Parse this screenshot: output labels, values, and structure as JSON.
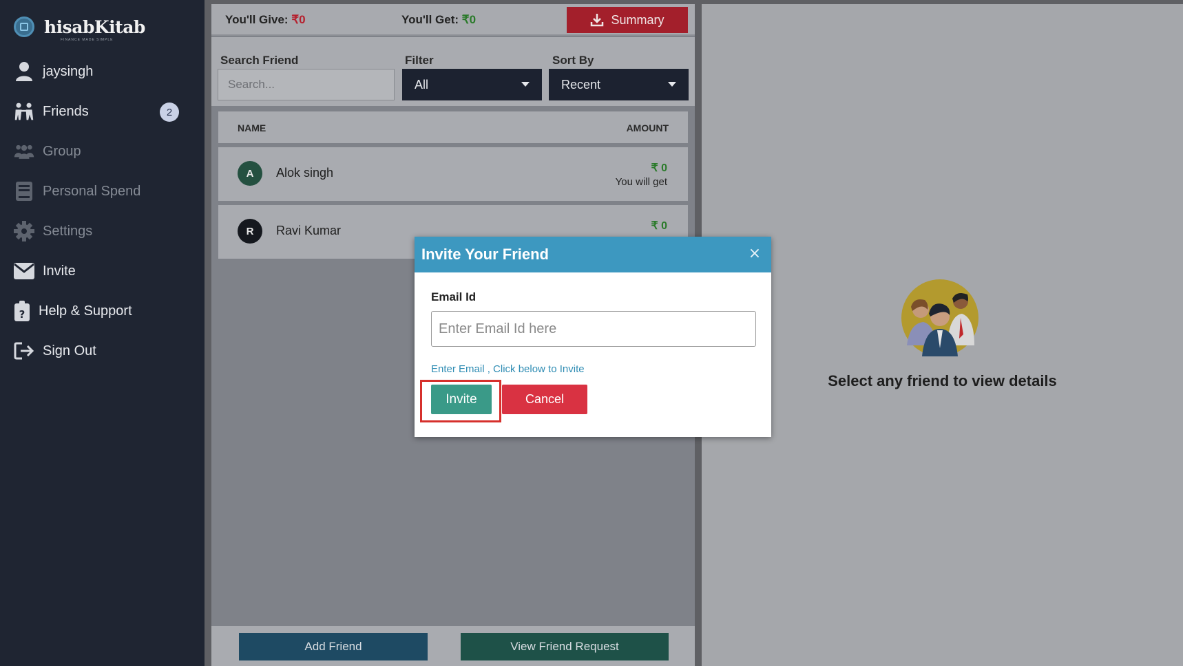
{
  "brand": {
    "name": "hisabKitab",
    "tagline": "FINANCE MADE SIMPLE"
  },
  "sidebar": {
    "items": [
      {
        "label": "jaysingh",
        "icon": "user-icon"
      },
      {
        "label": "Friends",
        "icon": "friends-icon",
        "badge": "2"
      },
      {
        "label": "Group",
        "icon": "group-icon"
      },
      {
        "label": "Personal Spend",
        "icon": "book-icon"
      },
      {
        "label": "Settings",
        "icon": "gear-icon"
      },
      {
        "label": "Invite",
        "icon": "envelope-icon"
      },
      {
        "label": "Help & Support",
        "icon": "clipboard-question-icon"
      },
      {
        "label": "Sign Out",
        "icon": "sign-out-icon"
      }
    ]
  },
  "balance": {
    "give_label": "You'll Give:",
    "give_value": "₹0",
    "get_label": "You'll Get:",
    "get_value": "₹0",
    "summary_label": "Summary"
  },
  "filters": {
    "search_label": "Search Friend",
    "search_placeholder": "Search...",
    "filter_label": "Filter",
    "filter_value": "All",
    "sort_label": "Sort By",
    "sort_value": "Recent"
  },
  "table": {
    "headers": {
      "name": "NAME",
      "amount": "AMOUNT"
    },
    "rows": [
      {
        "initial": "A",
        "name": "Alok singh",
        "amount": "₹ 0",
        "status": "You will get",
        "avatar_color": "#245040"
      },
      {
        "initial": "R",
        "name": "Ravi Kumar",
        "amount": "₹ 0",
        "status": "",
        "avatar_color": "#15181e"
      }
    ]
  },
  "actions": {
    "add_friend": "Add Friend",
    "view_requests": "View Friend Request"
  },
  "right_panel": {
    "message": "Select any friend to view details"
  },
  "modal": {
    "title": "Invite Your Friend",
    "close": "×",
    "email_label": "Email Id",
    "email_placeholder": "Enter Email Id here",
    "hint": "Enter Email , Click below to Invite",
    "invite_label": "Invite",
    "cancel_label": "Cancel"
  },
  "colors": {
    "sidebar": "#1f2532",
    "accent_red": "#a31f2b",
    "accent_green": "#3a9a88",
    "modal_header": "#3d98c0"
  }
}
